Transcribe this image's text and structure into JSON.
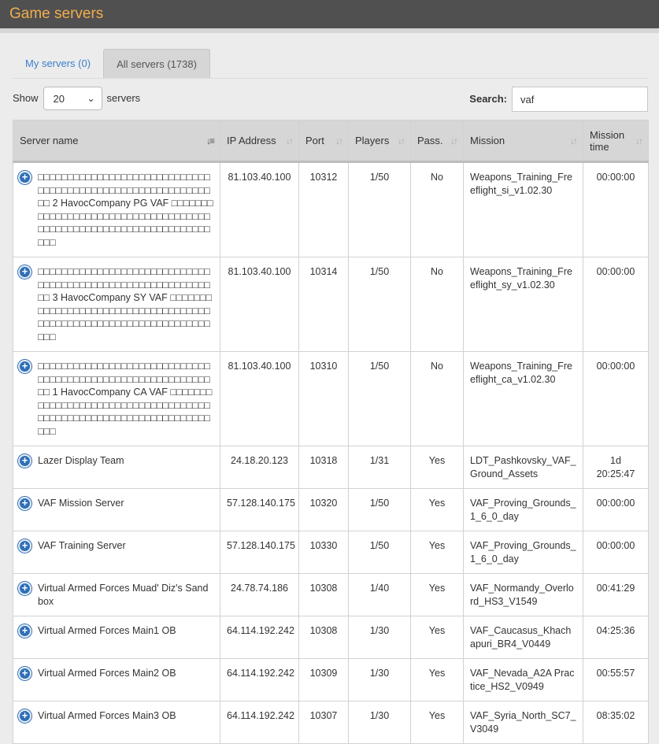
{
  "header": {
    "title": "Game servers"
  },
  "tabs": [
    {
      "label": "My servers (0)"
    },
    {
      "label": "All servers (1738)"
    }
  ],
  "controls": {
    "show_label": "Show",
    "length_value": "20",
    "servers_label": "servers",
    "search_label": "Search:",
    "search_value": "vaf"
  },
  "table": {
    "columns": [
      "Server name",
      "IP Address",
      "Port",
      "Players",
      "Pass.",
      "Mission",
      "Mission time"
    ],
    "rows": [
      {
        "name": "□□□□□□□□□□□□□□□□□□□□□□□□□□□□□□□□□□□□□□□□□□□□□□□□□□□□□□□□□□□□ 2 HavocCompany PG VAF □□□□□□□□□□□□□□□□□□□□□□□□□□□□□□□□□□□□□□□□□□□□□□□□□□□□□□□□□□□□□□□□□□□□",
        "ip": "81.103.40.100",
        "port": "10312",
        "players": "1/50",
        "pass": "No",
        "mission": "Weapons_Training_Freeflight_si_v1.02.30",
        "time": "00:00:00"
      },
      {
        "name": "□□□□□□□□□□□□□□□□□□□□□□□□□□□□□□□□□□□□□□□□□□□□□□□□□□□□□□□□□□□□ 3 HavocCompany SY VAF □□□□□□□□□□□□□□□□□□□□□□□□□□□□□□□□□□□□□□□□□□□□□□□□□□□□□□□□□□□□□□□□□□□□",
        "ip": "81.103.40.100",
        "port": "10314",
        "players": "1/50",
        "pass": "No",
        "mission": "Weapons_Training_Freeflight_sy_v1.02.30",
        "time": "00:00:00"
      },
      {
        "name": "□□□□□□□□□□□□□□□□□□□□□□□□□□□□□□□□□□□□□□□□□□□□□□□□□□□□□□□□□□□□ 1 HavocCompany CA VAF □□□□□□□□□□□□□□□□□□□□□□□□□□□□□□□□□□□□□□□□□□□□□□□□□□□□□□□□□□□□□□□□□□□□",
        "ip": "81.103.40.100",
        "port": "10310",
        "players": "1/50",
        "pass": "No",
        "mission": "Weapons_Training_Freeflight_ca_v1.02.30",
        "time": "00:00:00"
      },
      {
        "name": "Lazer Display Team",
        "ip": "24.18.20.123",
        "port": "10318",
        "players": "1/31",
        "pass": "Yes",
        "mission": "LDT_Pashkovsky_VAF_Ground_Assets",
        "time": "1d 20:25:47"
      },
      {
        "name": "VAF Mission Server",
        "ip": "57.128.140.175",
        "port": "10320",
        "players": "1/50",
        "pass": "Yes",
        "mission": "VAF_Proving_Grounds_1_6_0_day",
        "time": "00:00:00"
      },
      {
        "name": "VAF Training Server",
        "ip": "57.128.140.175",
        "port": "10330",
        "players": "1/50",
        "pass": "Yes",
        "mission": "VAF_Proving_Grounds_1_6_0_day",
        "time": "00:00:00"
      },
      {
        "name": "Virtual Armed Forces Muad' Diz's Sandbox",
        "ip": "24.78.74.186",
        "port": "10308",
        "players": "1/40",
        "pass": "Yes",
        "mission": "VAF_Normandy_Overlord_HS3_V1549",
        "time": "00:41:29"
      },
      {
        "name": "Virtual Armed Forces Main1 OB",
        "ip": "64.114.192.242",
        "port": "10308",
        "players": "1/30",
        "pass": "Yes",
        "mission": "VAF_Caucasus_Khachapuri_BR4_V0449",
        "time": "04:25:36"
      },
      {
        "name": "Virtual Armed Forces Main2 OB",
        "ip": "64.114.192.242",
        "port": "10309",
        "players": "1/30",
        "pass": "Yes",
        "mission": "VAF_Nevada_A2A Practice_HS2_V0949",
        "time": "00:55:57"
      },
      {
        "name": "Virtual Armed Forces Main3 OB",
        "ip": "64.114.192.242",
        "port": "10307",
        "players": "1/30",
        "pass": "Yes",
        "mission": "VAF_Syria_North_SC7_V3049",
        "time": "08:35:02"
      }
    ]
  },
  "icons": {
    "expand": "plus-circle-icon",
    "sort": "sort-arrows-icon",
    "sort_active": "sort-alpha-desc-icon",
    "dropdown": "chevron-down-icon"
  },
  "colors": {
    "accent": "#f0ad4e",
    "link": "#3a7fcb",
    "expand": "#2f6fb6",
    "header_bg": "#505050"
  }
}
